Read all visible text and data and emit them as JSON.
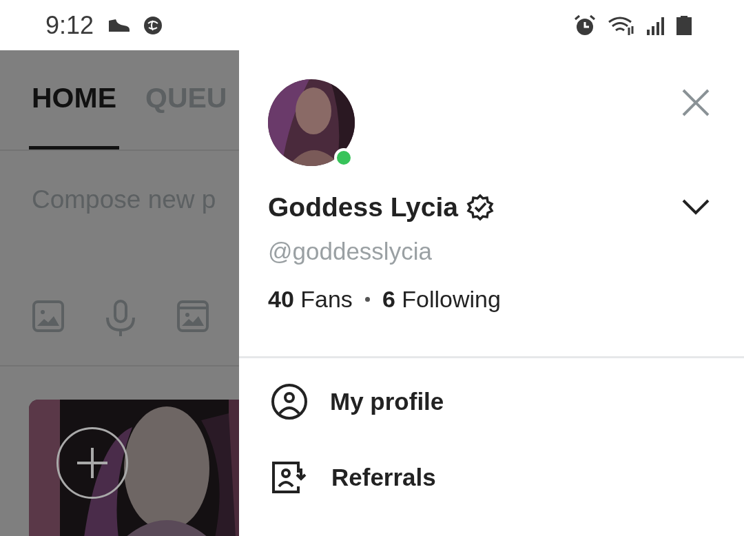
{
  "status_bar": {
    "time": "9:12"
  },
  "tabs": [
    {
      "label": "HOME",
      "selected": true
    },
    {
      "label": "QUEU",
      "selected": false
    }
  ],
  "composer": {
    "placeholder": "Compose new p"
  },
  "drawer": {
    "name": "Goddess Lycia",
    "verified": true,
    "online": true,
    "handle": "@goddesslycia",
    "stats": [
      {
        "count": "40",
        "label": "Fans"
      },
      {
        "count": "6",
        "label": "Following"
      }
    ],
    "menu": [
      {
        "kind": "profile",
        "label": "My profile"
      },
      {
        "kind": "referrals",
        "label": "Referrals"
      }
    ]
  }
}
